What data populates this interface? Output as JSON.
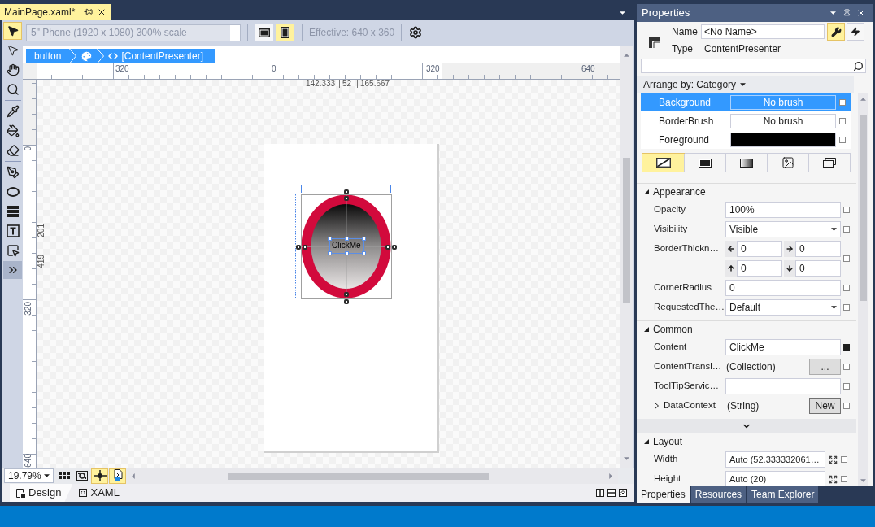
{
  "document_tab": {
    "title": "MainPage.xaml*",
    "selected": true
  },
  "designer": {
    "toolbox": [
      {
        "kind": "select",
        "selected": true
      },
      {
        "kind": "direct_select",
        "selected": false
      },
      {
        "kind": "pan",
        "selected": false
      },
      {
        "kind": "zoom",
        "selected": false,
        "separator_after": true
      },
      {
        "kind": "eyedropper",
        "selected": false
      },
      {
        "kind": "paint_bucket",
        "selected": false
      },
      {
        "kind": "gradient",
        "selected": false,
        "separator_after": true
      },
      {
        "kind": "pen",
        "selected": false
      },
      {
        "kind": "ellipse",
        "selected": false
      },
      {
        "kind": "grid",
        "selected": false
      },
      {
        "kind": "text",
        "selected": false
      },
      {
        "kind": "control",
        "selected": false
      },
      {
        "kind": "assets",
        "selected": false
      }
    ],
    "toolbar": {
      "device": "5\" Phone (1920 x 1080) 300% scale",
      "device_disabled": true,
      "orientations": [
        {
          "kind": "landscape",
          "selected": false
        },
        {
          "kind": "portrait",
          "selected": true
        }
      ],
      "effective": "Effective: 640 x 360"
    },
    "breadcrumb": [
      {
        "kind": "element",
        "label": "button"
      },
      {
        "kind": "style"
      },
      {
        "kind": "template",
        "label": "[ContentPresenter]"
      }
    ],
    "ruler_top": {
      "labels": [
        "320",
        "0",
        "320",
        "640"
      ],
      "measurements": [
        "142.333",
        "52",
        "165.667"
      ]
    },
    "ruler_left": {
      "labels": [
        "0",
        "320",
        "640"
      ],
      "measurements": [
        "201",
        "419"
      ]
    },
    "element": {
      "content": "ClickMe"
    },
    "zoom": "19.79%",
    "toggles": [
      {
        "kind": "grid",
        "on": false
      },
      {
        "kind": "snap_grid",
        "on": false
      },
      {
        "kind": "snap_lines",
        "on": true
      },
      {
        "kind": "project_code",
        "on": true
      }
    ],
    "view_tabs": [
      {
        "kind": "design",
        "label": "Design",
        "selected": true
      },
      {
        "kind": "xaml",
        "label": "XAML",
        "selected": false
      }
    ]
  },
  "properties": {
    "title": "Properties",
    "name_label": "Name",
    "name_value": "<No Name>",
    "type_label": "Type",
    "type_value": "ContentPresenter",
    "modes": [
      {
        "kind": "properties",
        "selected": true
      },
      {
        "kind": "events",
        "selected": false
      }
    ],
    "arrange_by": "Arrange by: Category",
    "brushes": [
      {
        "name": "Background",
        "kind": "text",
        "value": "No brush",
        "selected": true,
        "local": false
      },
      {
        "name": "BorderBrush",
        "kind": "text",
        "value": "No brush",
        "selected": false,
        "local": false
      },
      {
        "name": "Foreground",
        "kind": "color",
        "color": "#000000",
        "selected": false,
        "local": false
      }
    ],
    "brush_types": [
      {
        "kind": "none",
        "selected": true
      },
      {
        "kind": "solid",
        "selected": false
      },
      {
        "kind": "gradient",
        "selected": false
      },
      {
        "kind": "image",
        "selected": false
      },
      {
        "kind": "resource",
        "selected": false
      }
    ],
    "sections": [
      {
        "title": "Appearance",
        "expanded": true,
        "rows": [
          {
            "kind": "text",
            "label": "Opacity",
            "value": "100%",
            "local": false
          },
          {
            "kind": "dropdown",
            "label": "Visibility",
            "value": "Visible",
            "local": false
          },
          {
            "kind": "thickness",
            "label": "BorderThickn…",
            "values": [
              "0",
              "0",
              "0",
              "0"
            ],
            "local": false
          },
          {
            "kind": "text",
            "label": "CornerRadius",
            "value": "0",
            "local": false
          },
          {
            "kind": "dropdown",
            "label": "RequestedThe…",
            "value": "Default",
            "local": false
          }
        ]
      },
      {
        "title": "Common",
        "expanded": true,
        "advanced_expanded": false,
        "rows": [
          {
            "kind": "text",
            "label": "Content",
            "value": "ClickMe",
            "local": true
          },
          {
            "kind": "collection",
            "label": "ContentTransi…",
            "value": "(Collection)",
            "button": "...",
            "local": false
          },
          {
            "kind": "text",
            "label": "ToolTipServic…",
            "local": false
          },
          {
            "kind": "object",
            "label": "DataContext",
            "value": "(String)",
            "button": "New",
            "expanded": false,
            "local": false
          }
        ]
      },
      {
        "title": "Layout",
        "expanded": true,
        "rows": [
          {
            "kind": "size",
            "label": "Width",
            "value": "Auto (52.333332061…",
            "local": false
          },
          {
            "kind": "size",
            "label": "Height",
            "value": "Auto (20)",
            "local": false
          }
        ]
      }
    ],
    "tabs": [
      {
        "label": "Properties",
        "selected": true
      },
      {
        "label": "Resources",
        "selected": false
      },
      {
        "label": "Team Explorer",
        "selected": false
      }
    ]
  }
}
